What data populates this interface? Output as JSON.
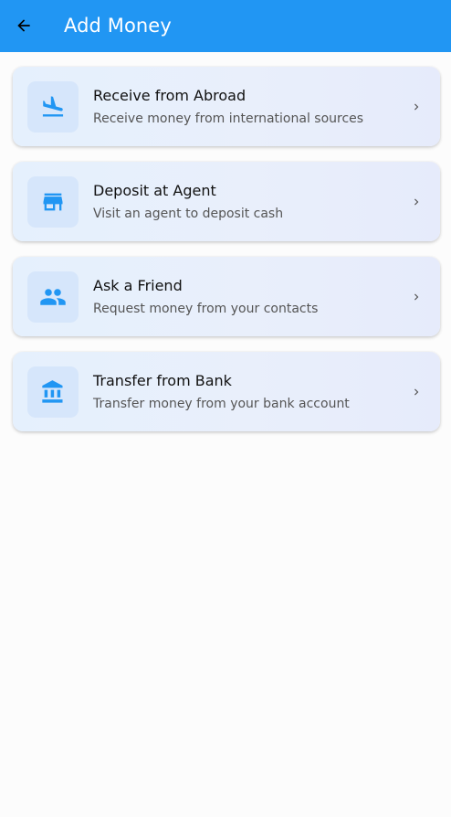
{
  "appbar": {
    "title": "Add Money",
    "back_icon": "arrow-back-icon",
    "background": "#2196f3"
  },
  "options": [
    {
      "title": "Receive from Abroad",
      "subtitle": "Receive money from international sources",
      "icon": "flight-land-icon"
    },
    {
      "title": "Deposit at Agent",
      "subtitle": "Visit an agent to deposit cash",
      "icon": "store-icon"
    },
    {
      "title": "Ask a Friend",
      "subtitle": "Request money from your contacts",
      "icon": "people-icon"
    },
    {
      "title": "Transfer from Bank",
      "subtitle": "Transfer money from your bank account",
      "icon": "bank-icon"
    }
  ],
  "colors": {
    "accent": "#2196f3",
    "icon": "#2196f3",
    "card_bg": "#e7eefc",
    "icon_bg": "#d6e6fb"
  }
}
